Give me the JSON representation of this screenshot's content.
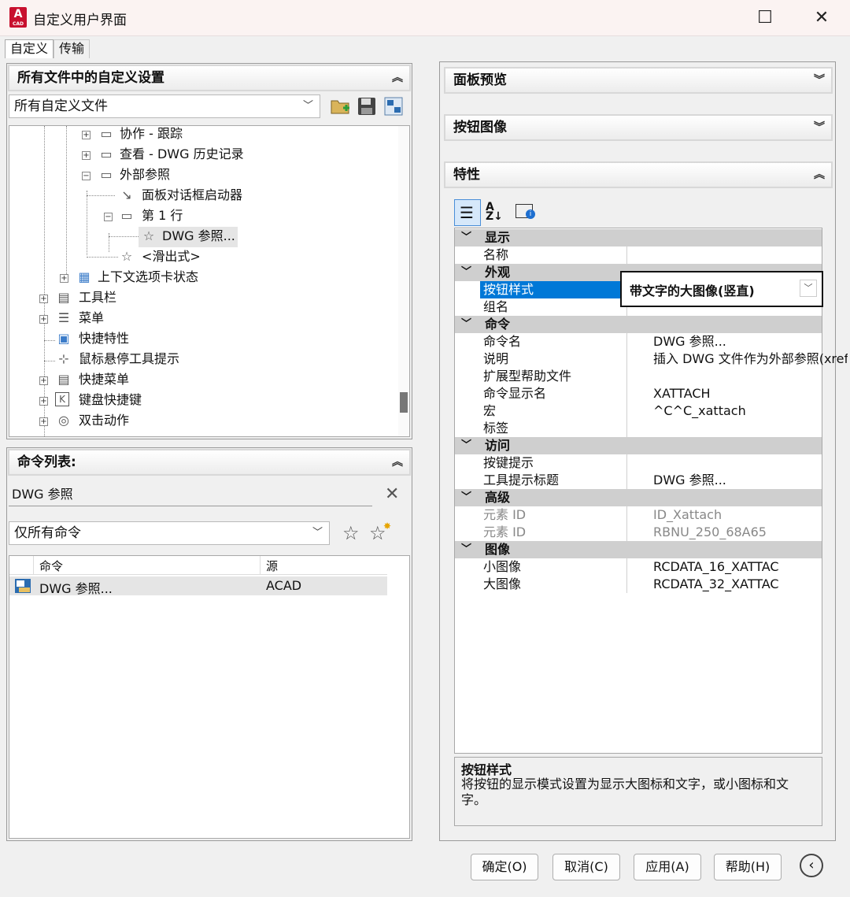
{
  "window": {
    "title": "自定义用户界面",
    "icon_text": "A",
    "icon_sub": "CAD"
  },
  "tabs": [
    "自定义",
    "传输"
  ],
  "left_top": {
    "header": "所有文件中的自定义设置",
    "combo": "所有自定义文件",
    "tree": [
      "协作 - 跟踪",
      "查看 - DWG 历史记录",
      "外部参照",
      "面板对话框启动器",
      "第 1 行",
      "DWG 参照...",
      "<滑出式>",
      "上下文选项卡状态",
      "工具栏",
      "菜单",
      "快捷特性",
      "鼠标悬停工具提示",
      "快捷菜单",
      "键盘快捷键",
      "双击动作"
    ]
  },
  "command_list": {
    "header": "命令列表:",
    "search_value": "DWG 参照",
    "filter": "仅所有命令",
    "columns": [
      "命令",
      "源"
    ],
    "rows": [
      {
        "name": "DWG 参照...",
        "source": "ACAD"
      }
    ]
  },
  "right": {
    "panel_preview": "面板预览",
    "button_image": "按钮图像",
    "properties": "特性",
    "cats": [
      "显示",
      "外观",
      "命令",
      "访问",
      "高级",
      "图像"
    ],
    "rows": [
      {
        "k": "名称",
        "v": ""
      },
      {
        "k": "按钮样式",
        "v": "带文字的大图像(竖直)"
      },
      {
        "k": "组名",
        "v": ""
      },
      {
        "k": "命令名",
        "v": "DWG 参照..."
      },
      {
        "k": "说明",
        "v": "插入 DWG 文件作为外部参照(xref)"
      },
      {
        "k": "扩展型帮助文件",
        "v": ""
      },
      {
        "k": "命令显示名",
        "v": "XATTACH"
      },
      {
        "k": "宏",
        "v": "^C^C_xattach"
      },
      {
        "k": "标签",
        "v": ""
      },
      {
        "k": "按键提示",
        "v": ""
      },
      {
        "k": "工具提示标题",
        "v": "DWG 参照..."
      },
      {
        "k": "元素 ID",
        "v": "ID_Xattach"
      },
      {
        "k": "元素 ID",
        "v": "RBNU_250_68A65"
      },
      {
        "k": "小图像",
        "v": "RCDATA_16_XATTAC"
      },
      {
        "k": "大图像",
        "v": "RCDATA_32_XATTAC"
      }
    ],
    "desc_title": "按钮样式",
    "desc_text": "将按钮的显示模式设置为显示大图标和文字，或小图标和文字。"
  },
  "buttons": {
    "ok": "确定(O)",
    "cancel": "取消(C)",
    "apply": "应用(A)",
    "help": "帮助(H)"
  },
  "colors": {
    "selection": "#0078d7",
    "category_bg": "#cfcfcf",
    "brand": "#c8102e"
  }
}
